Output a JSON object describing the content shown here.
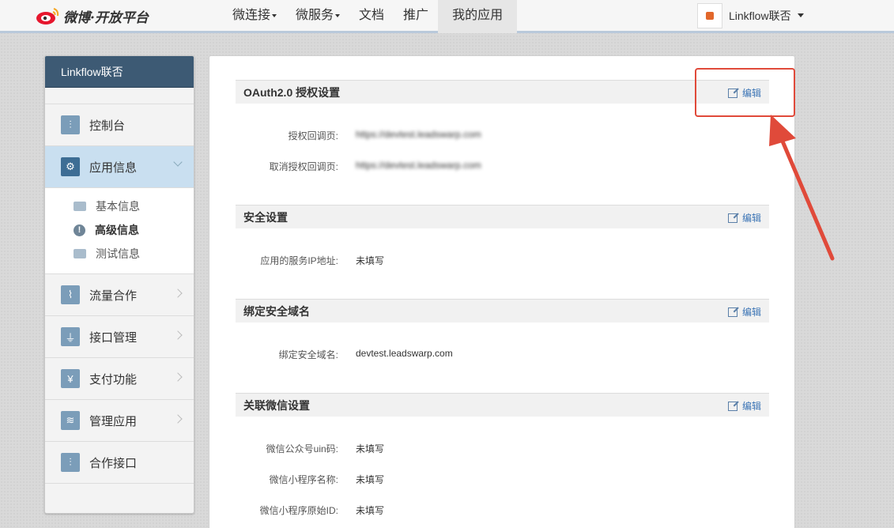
{
  "topbar": {
    "logo_text": "微博·开放平台",
    "nav": [
      {
        "label": "微连接",
        "caret": true
      },
      {
        "label": "微服务",
        "caret": true
      },
      {
        "label": "文档",
        "caret": false
      },
      {
        "label": "推广",
        "caret": false
      },
      {
        "label": "我的应用",
        "caret": false,
        "active": true
      }
    ],
    "user_name": "Linkflow联否"
  },
  "sidebar": {
    "title": "Linkflow联否",
    "items": [
      {
        "label": "控制台",
        "icon": "sliders-icon"
      },
      {
        "label": "应用信息",
        "icon": "gear-icon",
        "active": true
      },
      {
        "label": "流量合作",
        "icon": "chart-icon"
      },
      {
        "label": "接口管理",
        "icon": "plug-icon"
      },
      {
        "label": "支付功能",
        "icon": "yen-icon"
      },
      {
        "label": "管理应用",
        "icon": "layers-icon"
      },
      {
        "label": "合作接口",
        "icon": "sliders-icon"
      }
    ],
    "sub_items": [
      {
        "label": "基本信息",
        "icon": "card-icon"
      },
      {
        "label": "高级信息",
        "icon": "info-icon"
      },
      {
        "label": "测试信息",
        "icon": "id-card-icon"
      }
    ]
  },
  "sections": [
    {
      "title": "OAuth2.0 授权设置",
      "edit_label": "编辑",
      "rows": [
        {
          "label": "授权回调页:",
          "value": "https://devtest.leadswarp.com"
        },
        {
          "label": "取消授权回调页:",
          "value": "https://devtest.leadswarp.com"
        }
      ]
    },
    {
      "title": "安全设置",
      "edit_label": "编辑",
      "rows": [
        {
          "label": "应用的服务IP地址:",
          "value": "未填写"
        }
      ]
    },
    {
      "title": "绑定安全域名",
      "edit_label": "编辑",
      "rows": [
        {
          "label": "绑定安全域名:",
          "value": "devtest.leadswarp.com"
        }
      ]
    },
    {
      "title": "关联微信设置",
      "edit_label": "编辑",
      "rows": [
        {
          "label": "微信公众号uin码:",
          "value": "未填写"
        },
        {
          "label": "微信小程序名称:",
          "value": "未填写"
        },
        {
          "label": "微信小程序原始ID:",
          "value": "未填写"
        }
      ]
    }
  ],
  "colors": {
    "sidebar_header": "#3d5a74",
    "active_item": "#c9dff0",
    "link": "#3b74b5",
    "annotation": "#e04a3a"
  }
}
